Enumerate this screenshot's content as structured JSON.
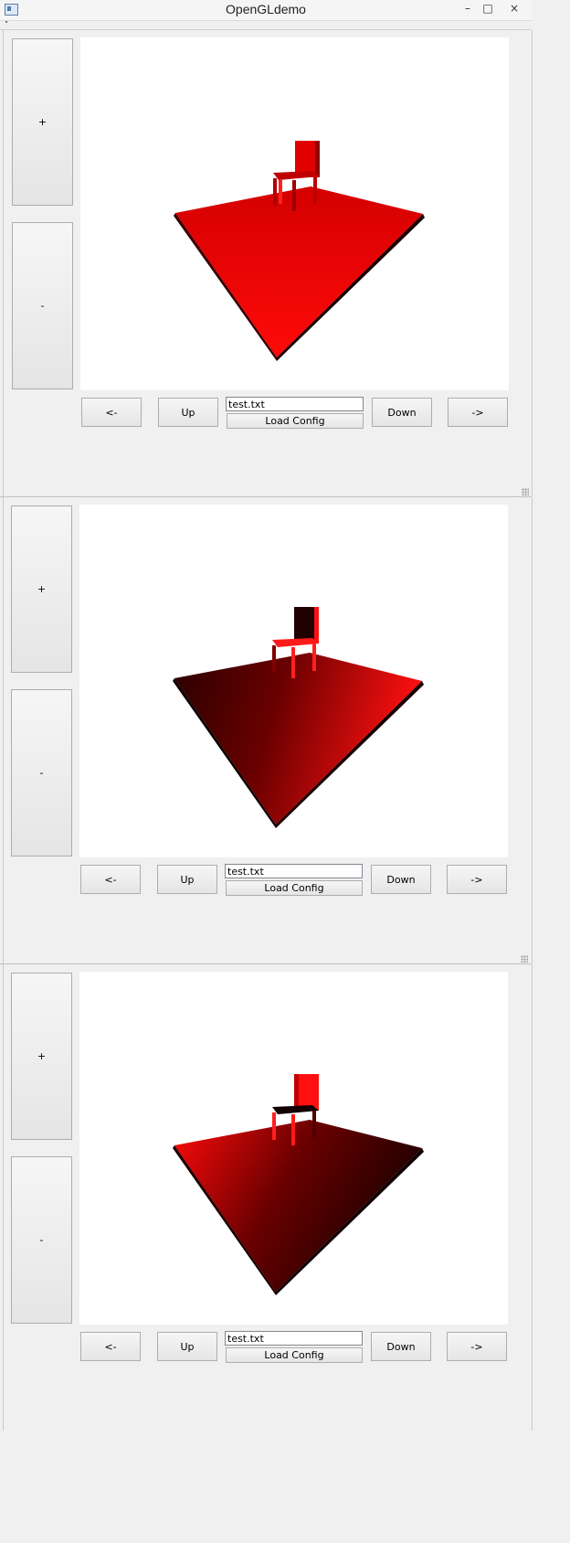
{
  "window": {
    "title": "OpenGLdemo",
    "min": "–",
    "max": "□",
    "close": "×"
  },
  "panels": [
    {
      "plus": "+",
      "minus": "-",
      "left": "<-",
      "up": "Up",
      "file_value": "test.txt",
      "load": "Load Config",
      "down": "Down",
      "right": "->"
    },
    {
      "plus": "+",
      "minus": "-",
      "left": "<-",
      "up": "Up",
      "file_value": "test.txt",
      "load": "Load Config",
      "down": "Down",
      "right": "->"
    },
    {
      "plus": "+",
      "minus": "-",
      "left": "<-",
      "up": "Up",
      "file_value": "test.txt",
      "load": "Load Config",
      "down": "Down",
      "right": "->"
    }
  ],
  "colors": {
    "accent_red": "#ff0000",
    "dark_red": "#3a0000",
    "background": "#f0f0f0",
    "viewport": "#ffffff"
  }
}
